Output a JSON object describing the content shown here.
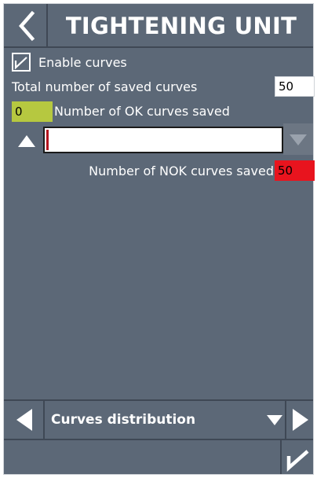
{
  "header": {
    "title": "TIGHTENING UNIT",
    "back_icon": "chevron-left-icon"
  },
  "settings": {
    "enable_curves": {
      "label": "Enable curves",
      "checked": true
    },
    "total_saved": {
      "label": "Total number of saved curves",
      "value": "50"
    },
    "ok_saved": {
      "label": "Number of OK curves saved",
      "value": "0",
      "color": "#b6c840"
    },
    "distribution_slider": {
      "value": 0,
      "min": 0,
      "max": 50
    },
    "nok_saved": {
      "label": "Number of NOK curves saved",
      "value": "50",
      "color": "#e8141e"
    }
  },
  "footer": {
    "selector_label": "Curves distribution",
    "prev_icon": "triangle-left-icon",
    "next_icon": "triangle-right-icon",
    "confirm_icon": "checkmark-icon"
  },
  "colors": {
    "background": "#5c6877",
    "divider": "#3f4855",
    "text": "#ffffff"
  }
}
